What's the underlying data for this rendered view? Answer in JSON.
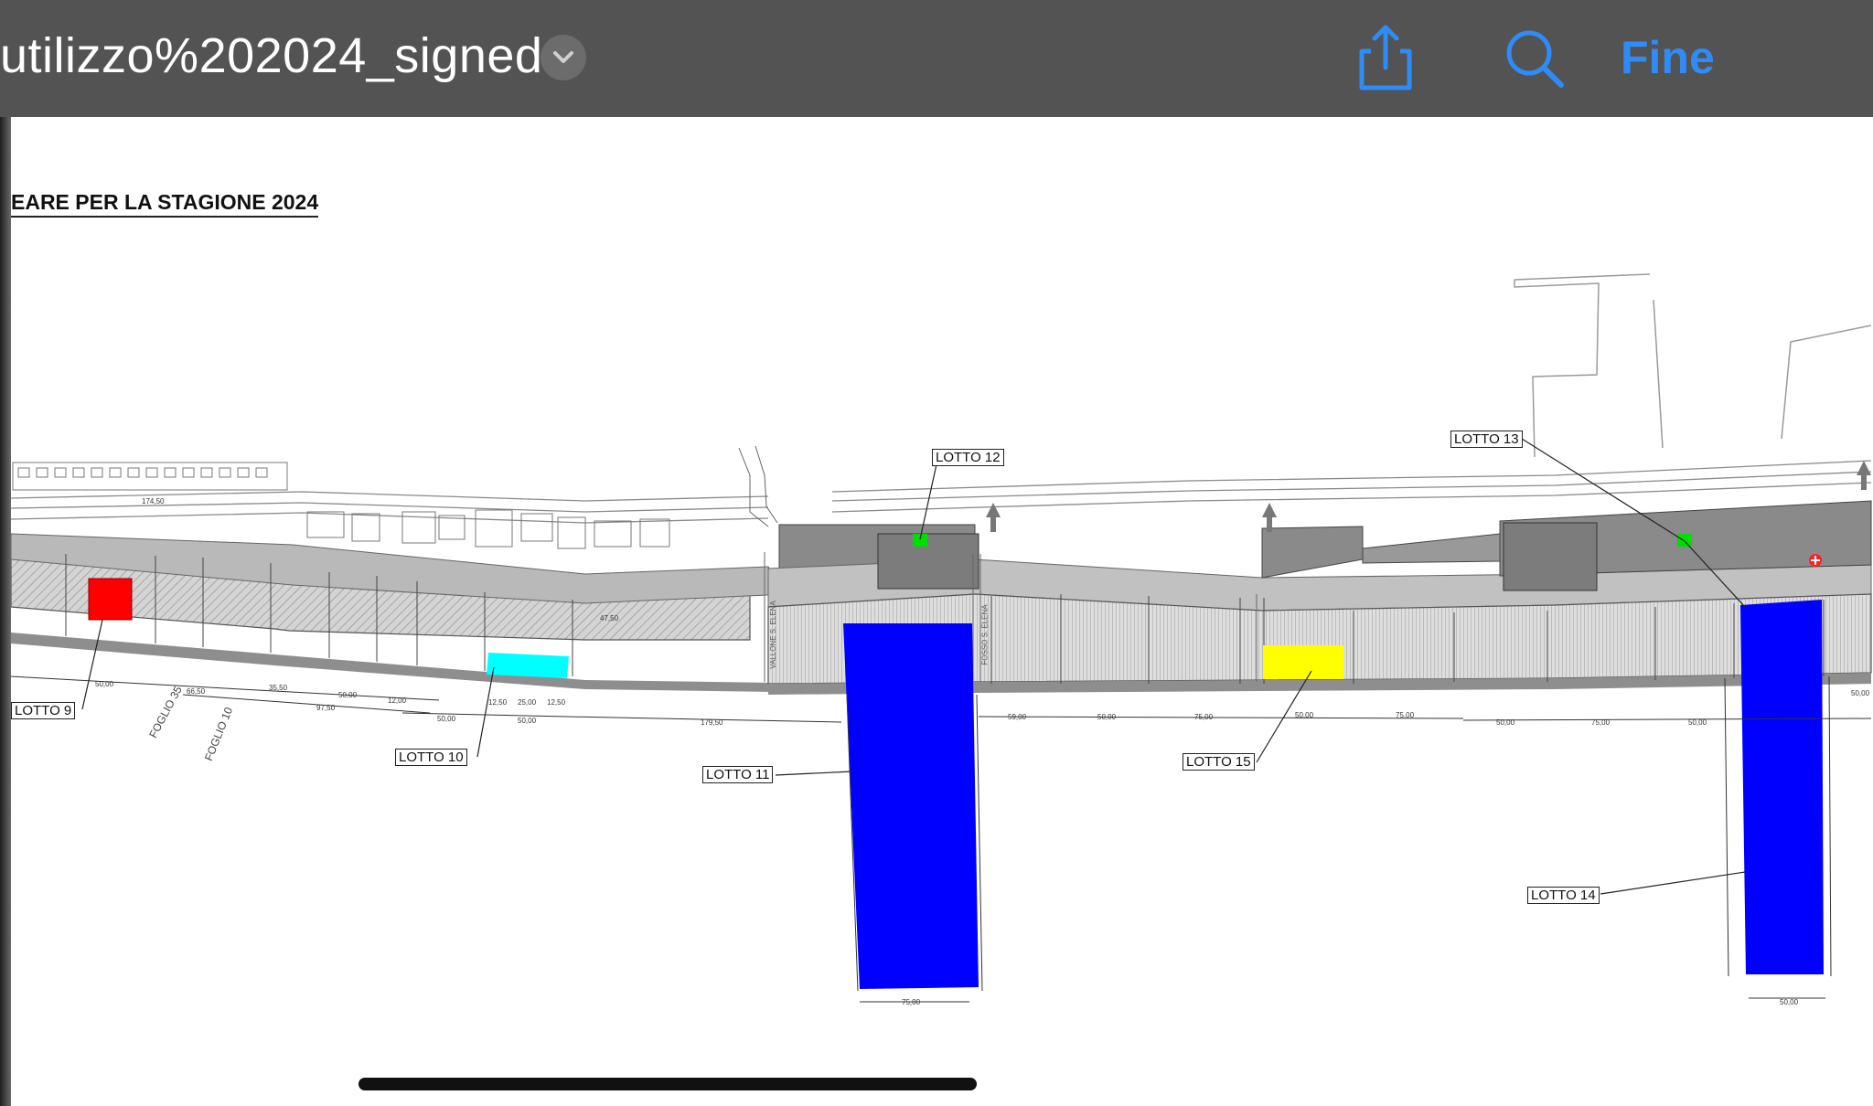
{
  "toolbar": {
    "document_title": "utilizzo%202024_signed",
    "done_label": "Fine",
    "icons": [
      "chevron-down-icon",
      "share-icon",
      "search-icon"
    ]
  },
  "document": {
    "heading": "EARE PER LA STAGIONE 2024",
    "lots": {
      "lotto_9": "LOTTO  9",
      "lotto_10": "LOTTO  10",
      "lotto_11": "LOTTO  11",
      "lotto_12": "LOTTO  12",
      "lotto_13": "LOTTO  13",
      "lotto_14": "LOTTO  14",
      "lotto_15": "LOTTO  15"
    },
    "plan_labels": {
      "foglio_35": "FOGLIO 35",
      "foglio_10": "FOGLIO 10",
      "vallone": "VALLONE S. ELENA",
      "fosso": "FOSSO S. ELENA"
    },
    "dimensions": {
      "d1": "50,00",
      "d2": "66,50",
      "d3": "35,50",
      "d4": "50,00",
      "d5": "12,00",
      "d6": "97,50",
      "d7": "50,00",
      "d8": "12,50",
      "d9": "25,00",
      "d10": "12,50",
      "d11": "50,00",
      "d12": "179,50",
      "d13": "59,00",
      "d14": "50,00",
      "d15": "75,00",
      "d16": "50,00",
      "d17": "75,00",
      "d18": "50,00",
      "d19": "75,00",
      "d20": "50,00",
      "d21": "50,00",
      "d22": "75,00",
      "d23": "50,00",
      "d24": "47,50",
      "d25": "174,50"
    },
    "highlight_colors": {
      "red": "#ff0000",
      "cyan": "#00ffff",
      "blue": "#0000ff",
      "yellow": "#ffff00",
      "green": "#00dd00"
    }
  }
}
